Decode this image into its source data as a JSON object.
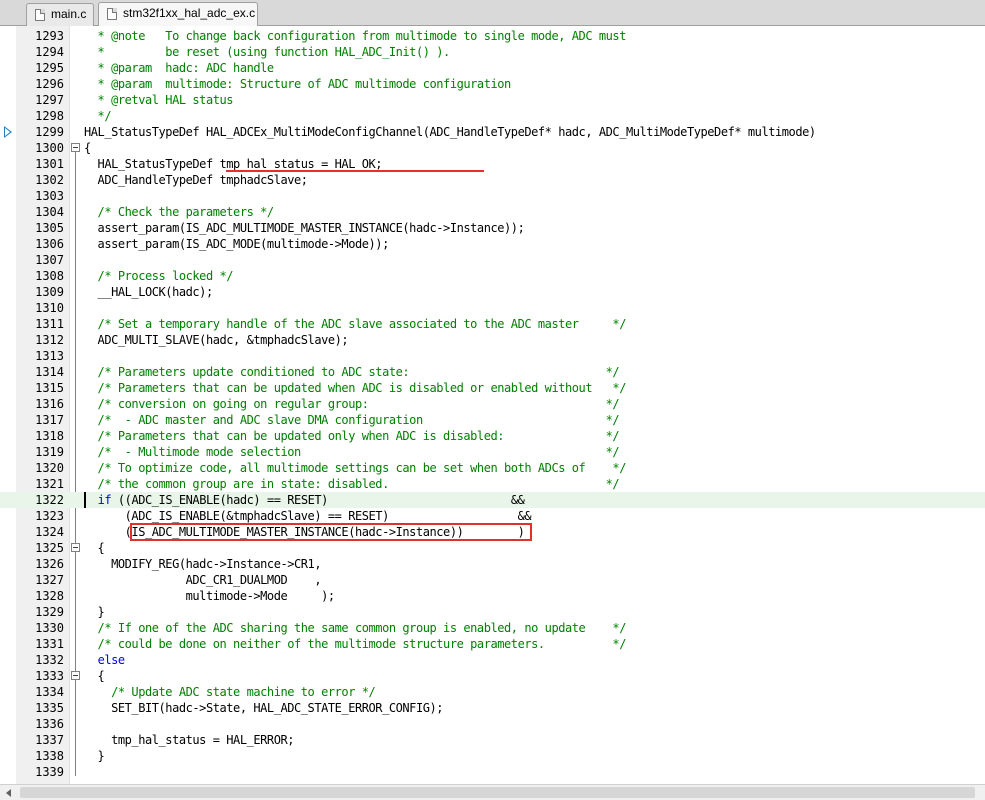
{
  "tabs": [
    {
      "label": "main.c",
      "active": false
    },
    {
      "label": "stm32f1xx_hal_adc_ex.c",
      "active": true
    }
  ],
  "colors": {
    "comment": "#008000",
    "keyword": "#0000ff",
    "annotation": "#e03030",
    "highlight_line": "#e8f5e8"
  },
  "editor": {
    "lines": [
      {
        "n": "1293",
        "segs": [
          {
            "t": "  * @note   To change back configuration from multimode to single mode, ADC must",
            "c": "cm"
          }
        ]
      },
      {
        "n": "1294",
        "segs": [
          {
            "t": "  *         be reset (using function HAL_ADC_Init() ).",
            "c": "cm"
          }
        ]
      },
      {
        "n": "1295",
        "segs": [
          {
            "t": "  * @param  hadc: ADC handle",
            "c": "cm"
          }
        ]
      },
      {
        "n": "1296",
        "segs": [
          {
            "t": "  * @param  multimode: Structure of ADC multimode configuration",
            "c": "cm"
          }
        ]
      },
      {
        "n": "1297",
        "segs": [
          {
            "t": "  * @retval HAL status",
            "c": "cm"
          }
        ]
      },
      {
        "n": "1298",
        "segs": [
          {
            "t": "  */",
            "c": "cm"
          }
        ]
      },
      {
        "n": "1299",
        "segs": [
          {
            "t": "HAL_StatusTypeDef HAL_ADCEx_MultiModeConfigChannel(ADC_HandleTypeDef* hadc, ADC_MultiModeTypeDef* multimode)",
            "c": ""
          }
        ]
      },
      {
        "n": "1300",
        "segs": [
          {
            "t": "{",
            "c": ""
          }
        ]
      },
      {
        "n": "1301",
        "segs": [
          {
            "t": "  HAL_StatusTypeDef tmp_hal_status = HAL_OK;",
            "c": ""
          }
        ]
      },
      {
        "n": "1302",
        "segs": [
          {
            "t": "  ADC_HandleTypeDef tmphadcSlave;",
            "c": ""
          }
        ]
      },
      {
        "n": "1303",
        "segs": [
          {
            "t": "",
            "c": ""
          }
        ]
      },
      {
        "n": "1304",
        "segs": [
          {
            "t": "  /* Check the parameters */",
            "c": "cm"
          }
        ]
      },
      {
        "n": "1305",
        "segs": [
          {
            "t": "  assert_param(IS_ADC_MULTIMODE_MASTER_INSTANCE(hadc->Instance));",
            "c": ""
          }
        ]
      },
      {
        "n": "1306",
        "segs": [
          {
            "t": "  assert_param(IS_ADC_MODE(multimode->Mode));",
            "c": ""
          }
        ]
      },
      {
        "n": "1307",
        "segs": [
          {
            "t": "",
            "c": ""
          }
        ]
      },
      {
        "n": "1308",
        "segs": [
          {
            "t": "  /* Process locked */",
            "c": "cm"
          }
        ]
      },
      {
        "n": "1309",
        "segs": [
          {
            "t": "  __HAL_LOCK(hadc);",
            "c": ""
          }
        ]
      },
      {
        "n": "1310",
        "segs": [
          {
            "t": "",
            "c": ""
          }
        ]
      },
      {
        "n": "1311",
        "segs": [
          {
            "t": "  /* Set a temporary handle of the ADC slave associated to the ADC master     */",
            "c": "cm"
          }
        ]
      },
      {
        "n": "1312",
        "segs": [
          {
            "t": "  ADC_MULTI_SLAVE(hadc, &tmphadcSlave);",
            "c": ""
          }
        ]
      },
      {
        "n": "1313",
        "segs": [
          {
            "t": "",
            "c": ""
          }
        ]
      },
      {
        "n": "1314",
        "segs": [
          {
            "t": "  /* Parameters update conditioned to ADC state:                             */",
            "c": "cm"
          }
        ]
      },
      {
        "n": "1315",
        "segs": [
          {
            "t": "  /* Parameters that can be updated when ADC is disabled or enabled without   */",
            "c": "cm"
          }
        ]
      },
      {
        "n": "1316",
        "segs": [
          {
            "t": "  /* conversion on going on regular group:                                   */",
            "c": "cm"
          }
        ]
      },
      {
        "n": "1317",
        "segs": [
          {
            "t": "  /*  - ADC master and ADC slave DMA configuration                           */",
            "c": "cm"
          }
        ]
      },
      {
        "n": "1318",
        "segs": [
          {
            "t": "  /* Parameters that can be updated only when ADC is disabled:               */",
            "c": "cm"
          }
        ]
      },
      {
        "n": "1319",
        "segs": [
          {
            "t": "  /*  - Multimode mode selection                                             */",
            "c": "cm"
          }
        ]
      },
      {
        "n": "1320",
        "segs": [
          {
            "t": "  /* To optimize code, all multimode settings can be set when both ADCs of    */",
            "c": "cm"
          }
        ]
      },
      {
        "n": "1321",
        "segs": [
          {
            "t": "  /* the common group are in state: disabled.                                */",
            "c": "cm"
          }
        ]
      },
      {
        "n": "1322",
        "segs": [
          {
            "t": "  ",
            "c": ""
          },
          {
            "t": "if",
            "c": "kw"
          },
          {
            "t": " ((ADC_IS_ENABLE(hadc) == RESET)                           &&",
            "c": ""
          }
        ]
      },
      {
        "n": "1323",
        "segs": [
          {
            "t": "      (ADC_IS_ENABLE(&tmphadcSlave) == RESET)                   &&",
            "c": ""
          }
        ]
      },
      {
        "n": "1324",
        "segs": [
          {
            "t": "      (IS_ADC_MULTIMODE_MASTER_INSTANCE(hadc->Instance))        )",
            "c": ""
          }
        ]
      },
      {
        "n": "1325",
        "segs": [
          {
            "t": "  {",
            "c": ""
          }
        ]
      },
      {
        "n": "1326",
        "segs": [
          {
            "t": "    MODIFY_REG(hadc->Instance->CR1,",
            "c": ""
          }
        ]
      },
      {
        "n": "1327",
        "segs": [
          {
            "t": "               ADC_CR1_DUALMOD    ,",
            "c": ""
          }
        ]
      },
      {
        "n": "1328",
        "segs": [
          {
            "t": "               multimode->Mode     );",
            "c": ""
          }
        ]
      },
      {
        "n": "1329",
        "segs": [
          {
            "t": "  }",
            "c": ""
          }
        ]
      },
      {
        "n": "1330",
        "segs": [
          {
            "t": "  /* If one of the ADC sharing the same common group is enabled, no update    */",
            "c": "cm"
          }
        ]
      },
      {
        "n": "1331",
        "segs": [
          {
            "t": "  /* could be done on neither of the multimode structure parameters.          */",
            "c": "cm"
          }
        ]
      },
      {
        "n": "1332",
        "segs": [
          {
            "t": "  ",
            "c": ""
          },
          {
            "t": "else",
            "c": "kw"
          }
        ]
      },
      {
        "n": "1333",
        "segs": [
          {
            "t": "  {",
            "c": ""
          }
        ]
      },
      {
        "n": "1334",
        "segs": [
          {
            "t": "    /* Update ADC state machine to error */",
            "c": "cm"
          }
        ]
      },
      {
        "n": "1335",
        "segs": [
          {
            "t": "    SET_BIT(hadc->State, HAL_ADC_STATE_ERROR_CONFIG);",
            "c": ""
          }
        ]
      },
      {
        "n": "1336",
        "segs": [
          {
            "t": "",
            "c": ""
          }
        ]
      },
      {
        "n": "1337",
        "segs": [
          {
            "t": "    tmp_hal_status = HAL_ERROR;",
            "c": ""
          }
        ]
      },
      {
        "n": "1338",
        "segs": [
          {
            "t": "  }",
            "c": ""
          }
        ]
      },
      {
        "n": "1339",
        "segs": [
          {
            "t": "",
            "c": ""
          }
        ]
      }
    ]
  }
}
